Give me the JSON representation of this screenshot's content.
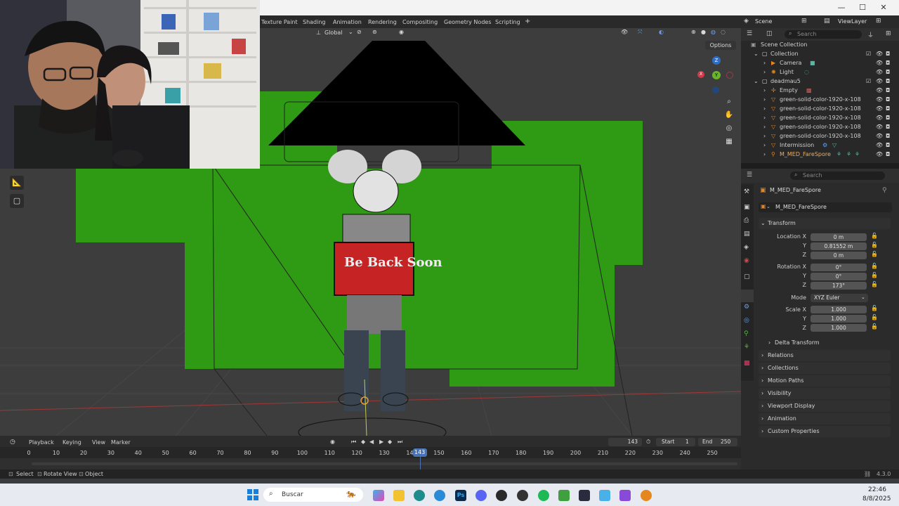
{
  "title_bar": {
    "minimize": "—",
    "maximize": "☐",
    "close": "✕"
  },
  "workspace_tabs": [
    "Texture Paint",
    "Shading",
    "Animation",
    "Rendering",
    "Compositing",
    "Geometry Nodes",
    "Scripting"
  ],
  "workspace_add": "+",
  "viewport": {
    "transform_orientation": "Global",
    "options_label": "Options",
    "overlay_text": "Be Back Soon",
    "gizmo": {
      "z": "Z",
      "y": "Y",
      "x": "X"
    }
  },
  "header_right": {
    "scene": "Scene",
    "view_layer": "ViewLayer"
  },
  "outliner": {
    "search_placeholder": "Search",
    "items": [
      {
        "label": "Scene Collection",
        "indent": 0
      },
      {
        "label": "Collection",
        "indent": 1
      },
      {
        "label": "Camera",
        "indent": 2
      },
      {
        "label": "Light",
        "indent": 2
      },
      {
        "label": "deadmau5",
        "indent": 1
      },
      {
        "label": "Empty",
        "indent": 2
      },
      {
        "label": "green-solid-color-1920-x-108",
        "indent": 2
      },
      {
        "label": "green-solid-color-1920-x-108",
        "indent": 2
      },
      {
        "label": "green-solid-color-1920-x-108",
        "indent": 2
      },
      {
        "label": "green-solid-color-1920-x-108",
        "indent": 2
      },
      {
        "label": "green-solid-color-1920-x-108",
        "indent": 2
      },
      {
        "label": "Intermission",
        "indent": 2
      },
      {
        "label": "M_MED_FareSpore",
        "indent": 2
      }
    ]
  },
  "properties": {
    "search_placeholder": "Search",
    "object_name": "M_MED_FareSpore",
    "object_field": "M_MED_FareSpore",
    "transform_label": "Transform",
    "location": {
      "label": "Location X",
      "x": "0 m",
      "y": "0.81552 m",
      "z": "0 m"
    },
    "rotation": {
      "label": "Rotation X",
      "x": "0°",
      "y": "0°",
      "z": "173°"
    },
    "mode": {
      "label": "Mode",
      "value": "XYZ Euler"
    },
    "scale": {
      "label": "Scale X",
      "x": "1.000",
      "y": "1.000",
      "z": "1.000"
    },
    "axis_y": "Y",
    "axis_z": "Z",
    "sections": [
      "Delta Transform",
      "Relations",
      "Collections",
      "Motion Paths",
      "Visibility",
      "Viewport Display",
      "Animation",
      "Custom Properties"
    ]
  },
  "timeline": {
    "menu": [
      "Playback",
      "Keying",
      "View",
      "Marker"
    ],
    "current_frame": "143",
    "start_label": "Start",
    "start_value": "1",
    "end_label": "End",
    "end_value": "250",
    "ticks": [
      "0",
      "10",
      "20",
      "30",
      "40",
      "50",
      "60",
      "70",
      "80",
      "90",
      "100",
      "110",
      "120",
      "130",
      "140",
      "150",
      "160",
      "170",
      "180",
      "190",
      "200",
      "210",
      "220",
      "230",
      "240",
      "250"
    ],
    "playhead": "143"
  },
  "status_bar": {
    "select": "Select",
    "rotate": "Rotate View",
    "object": "Object",
    "version": "4.3.0"
  },
  "taskbar": {
    "search_placeholder": "Buscar",
    "time": "22:46",
    "date": "8/8/2025"
  },
  "colors": {
    "green_screen": "#2f9b14",
    "viewport_bg": "#3d3d3d",
    "active_orange": "#e6861f",
    "playhead_blue": "#4772b3"
  }
}
